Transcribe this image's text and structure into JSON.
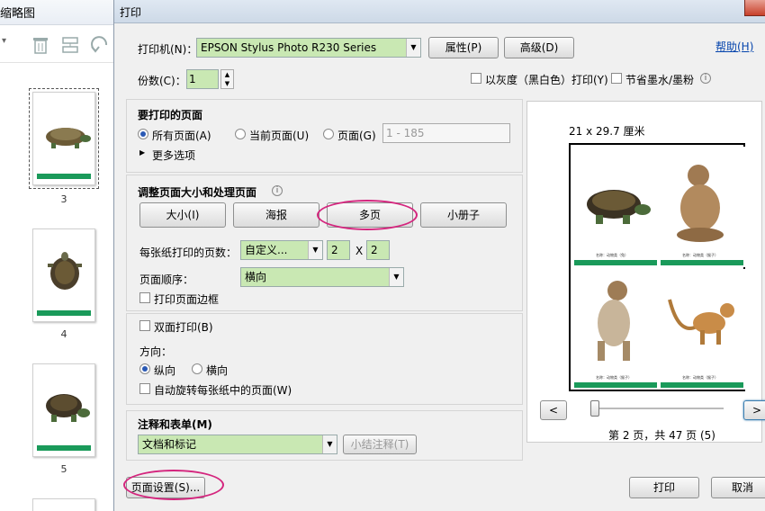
{
  "thumb_panel": {
    "title": "缩略图",
    "pages": [
      "3",
      "4",
      "5"
    ]
  },
  "dialog": {
    "title": "打印",
    "help_link": "帮助(H)",
    "printer_label": "打印机(N)：",
    "printer_value": "EPSON Stylus Photo R230 Series",
    "properties_button": "属性(P)",
    "advanced_button": "高级(D)",
    "copies_label": "份数(C)：",
    "copies_value": "1",
    "grayscale_label": "以灰度（黑白色）打印(Y)",
    "save_ink_label": "节省墨水/墨粉",
    "pages_section": {
      "title": "要打印的页面",
      "all_pages": "所有页面(A)",
      "current_page": "当前页面(U)",
      "pages_option": "页面(G)",
      "pages_range_placeholder": "1 - 185",
      "more_options": "更多选项"
    },
    "sizing_section": {
      "title": "调整页面大小和处理页面",
      "size_button": "大小(I)",
      "poster_button": "海报",
      "multiple_button": "多页",
      "booklet_button": "小册子",
      "pages_per_sheet_label": "每张纸打印的页数：",
      "pages_per_sheet_value": "自定义...",
      "cols_value": "2",
      "x_label": "X",
      "rows_value": "2",
      "page_order_label": "页面顺序：",
      "page_order_value": "横向",
      "print_border_label": "打印页面边框"
    },
    "duplex_label": "双面打印(B)",
    "orientation_section": {
      "title": "方向：",
      "portrait": "纵向",
      "landscape": "横向",
      "auto_rotate": "自动旋转每张纸中的页面(W)"
    },
    "comments_section": {
      "title": "注释和表单(M)",
      "value": "文档和标记",
      "summarize_button": "小结注释(T)"
    },
    "page_setup_button": "页面设置(S)...",
    "print_button": "打印",
    "cancel_button": "取消",
    "preview": {
      "paper_size": "21 x 29.7 厘米",
      "page_status": "第 2 页，共 47 页 (5)",
      "prev_button": "<",
      "next_button": ">",
      "captions": [
        "名称：动物类（兔）",
        "名称：动物类（猴子）",
        "名称：动物类（猴子）",
        "名称：动物类（猴子）"
      ]
    }
  },
  "colors": {
    "accent_green": "#c9e8b3",
    "highlight_ellipse": "#d4267e",
    "footer_green": "#1a9a5a"
  }
}
